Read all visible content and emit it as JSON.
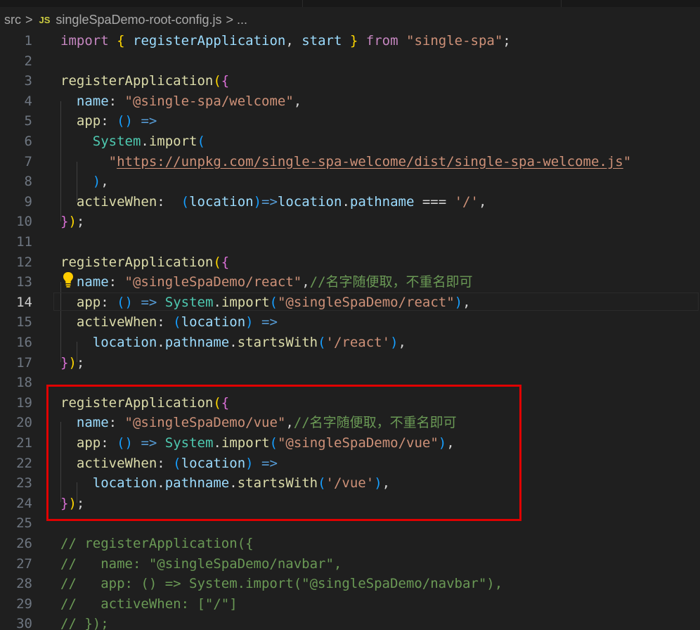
{
  "breadcrumb": {
    "folder": "src",
    "separator": ">",
    "file_icon": "JS",
    "file_name": "singleSpaDemo-root-config.js",
    "more": "..."
  },
  "editor": {
    "active_line": 14,
    "line_numbers": [
      "1",
      "2",
      "3",
      "4",
      "5",
      "6",
      "7",
      "8",
      "9",
      "10",
      "11",
      "12",
      "13",
      "14",
      "15",
      "16",
      "17",
      "18",
      "19",
      "20",
      "21",
      "22",
      "23",
      "24",
      "25",
      "26",
      "27",
      "28",
      "29",
      "30"
    ],
    "lines": [
      [
        [
          "kw",
          "import"
        ],
        [
          "txt",
          " "
        ],
        [
          "p1",
          "{"
        ],
        [
          "txt",
          " "
        ],
        [
          "prop",
          "registerApplication"
        ],
        [
          "txt",
          ", "
        ],
        [
          "prop",
          "start"
        ],
        [
          "txt",
          " "
        ],
        [
          "p1",
          "}"
        ],
        [
          "txt",
          " "
        ],
        [
          "kw",
          "from"
        ],
        [
          "txt",
          " "
        ],
        [
          "str",
          "\"single-spa\""
        ],
        [
          "txt",
          ";"
        ]
      ],
      [],
      [
        [
          "fn",
          "registerApplication"
        ],
        [
          "p1",
          "("
        ],
        [
          "p2",
          "{"
        ]
      ],
      [
        [
          "txt",
          "  "
        ],
        [
          "prop",
          "name"
        ],
        [
          "txt",
          ": "
        ],
        [
          "str",
          "\"@single-spa/welcome\""
        ],
        [
          "txt",
          ","
        ]
      ],
      [
        [
          "txt",
          "  "
        ],
        [
          "fn",
          "app"
        ],
        [
          "txt",
          ": "
        ],
        [
          "p3",
          "()"
        ],
        [
          "txt",
          " "
        ],
        [
          "kw2",
          "=>"
        ]
      ],
      [
        [
          "txt",
          "    "
        ],
        [
          "cls",
          "System"
        ],
        [
          "txt",
          "."
        ],
        [
          "fn",
          "import"
        ],
        [
          "p3",
          "("
        ]
      ],
      [
        [
          "txt",
          "      "
        ],
        [
          "str",
          "\""
        ],
        [
          "str url",
          "https://unpkg.com/single-spa-welcome/dist/single-spa-welcome.js"
        ],
        [
          "str",
          "\""
        ]
      ],
      [
        [
          "txt",
          "    "
        ],
        [
          "p3",
          ")"
        ],
        [
          "txt",
          ","
        ]
      ],
      [
        [
          "txt",
          "  "
        ],
        [
          "fn",
          "activeWhen"
        ],
        [
          "txt",
          ":  "
        ],
        [
          "p3",
          "("
        ],
        [
          "prop",
          "location"
        ],
        [
          "p3",
          ")"
        ],
        [
          "kw2",
          "=>"
        ],
        [
          "prop",
          "location"
        ],
        [
          "txt",
          "."
        ],
        [
          "prop",
          "pathname"
        ],
        [
          "txt",
          " === "
        ],
        [
          "str",
          "'/'"
        ],
        [
          "txt",
          ","
        ]
      ],
      [
        [
          "p2",
          "}"
        ],
        [
          "p1",
          ")"
        ],
        [
          "txt",
          ";"
        ]
      ],
      [],
      [
        [
          "fn",
          "registerApplication"
        ],
        [
          "p1",
          "("
        ],
        [
          "p2",
          "{"
        ]
      ],
      [
        [
          "txt",
          "  "
        ],
        [
          "prop",
          "name"
        ],
        [
          "txt",
          ": "
        ],
        [
          "str",
          "\"@singleSpaDemo/react\""
        ],
        [
          "txt",
          ","
        ],
        [
          "cmt",
          "//名字随便取，不重名即可"
        ]
      ],
      [
        [
          "txt",
          "  "
        ],
        [
          "fn",
          "app"
        ],
        [
          "txt",
          ": "
        ],
        [
          "p3",
          "()"
        ],
        [
          "txt",
          " "
        ],
        [
          "kw2",
          "=>"
        ],
        [
          "txt",
          " "
        ],
        [
          "cls",
          "System"
        ],
        [
          "txt",
          "."
        ],
        [
          "fn",
          "import"
        ],
        [
          "p3",
          "("
        ],
        [
          "str",
          "\"@singleSpaDemo/react\""
        ],
        [
          "p3",
          ")"
        ],
        [
          "txt",
          ","
        ]
      ],
      [
        [
          "txt",
          "  "
        ],
        [
          "fn",
          "activeWhen"
        ],
        [
          "txt",
          ": "
        ],
        [
          "p3",
          "("
        ],
        [
          "prop",
          "location"
        ],
        [
          "p3",
          ")"
        ],
        [
          "txt",
          " "
        ],
        [
          "kw2",
          "=>"
        ]
      ],
      [
        [
          "txt",
          "    "
        ],
        [
          "prop",
          "location"
        ],
        [
          "txt",
          "."
        ],
        [
          "prop",
          "pathname"
        ],
        [
          "txt",
          "."
        ],
        [
          "fn",
          "startsWith"
        ],
        [
          "p3",
          "("
        ],
        [
          "str",
          "'/react'"
        ],
        [
          "p3",
          ")"
        ],
        [
          "txt",
          ","
        ]
      ],
      [
        [
          "p2",
          "}"
        ],
        [
          "p1",
          ")"
        ],
        [
          "txt",
          ";"
        ]
      ],
      [],
      [
        [
          "fn",
          "registerApplication"
        ],
        [
          "p1",
          "("
        ],
        [
          "p2",
          "{"
        ]
      ],
      [
        [
          "txt",
          "  "
        ],
        [
          "prop",
          "name"
        ],
        [
          "txt",
          ": "
        ],
        [
          "str",
          "\"@singleSpaDemo/vue\""
        ],
        [
          "txt",
          ","
        ],
        [
          "cmt",
          "//名字随便取，不重名即可"
        ]
      ],
      [
        [
          "txt",
          "  "
        ],
        [
          "fn",
          "app"
        ],
        [
          "txt",
          ": "
        ],
        [
          "p3",
          "()"
        ],
        [
          "txt",
          " "
        ],
        [
          "kw2",
          "=>"
        ],
        [
          "txt",
          " "
        ],
        [
          "cls",
          "System"
        ],
        [
          "txt",
          "."
        ],
        [
          "fn",
          "import"
        ],
        [
          "p3",
          "("
        ],
        [
          "str",
          "\"@singleSpaDemo/vue\""
        ],
        [
          "p3",
          ")"
        ],
        [
          "txt",
          ","
        ]
      ],
      [
        [
          "txt",
          "  "
        ],
        [
          "fn",
          "activeWhen"
        ],
        [
          "txt",
          ": "
        ],
        [
          "p3",
          "("
        ],
        [
          "prop",
          "location"
        ],
        [
          "p3",
          ")"
        ],
        [
          "txt",
          " "
        ],
        [
          "kw2",
          "=>"
        ]
      ],
      [
        [
          "txt",
          "    "
        ],
        [
          "prop",
          "location"
        ],
        [
          "txt",
          "."
        ],
        [
          "prop",
          "pathname"
        ],
        [
          "txt",
          "."
        ],
        [
          "fn",
          "startsWith"
        ],
        [
          "p3",
          "("
        ],
        [
          "str",
          "'/vue'"
        ],
        [
          "p3",
          ")"
        ],
        [
          "txt",
          ","
        ]
      ],
      [
        [
          "p2",
          "}"
        ],
        [
          "p1",
          ")"
        ],
        [
          "txt",
          ";"
        ]
      ],
      [],
      [
        [
          "cmt",
          "// registerApplication({"
        ]
      ],
      [
        [
          "cmt",
          "//   name: \"@singleSpaDemo/navbar\","
        ]
      ],
      [
        [
          "cmt",
          "//   app: () => System.import(\"@singleSpaDemo/navbar\"),"
        ]
      ],
      [
        [
          "cmt",
          "//   activeWhen: [\"/\"]"
        ]
      ],
      [
        [
          "cmt",
          "// });"
        ]
      ]
    ]
  },
  "colors": {
    "background": "#1f1f1f",
    "highlight_box": "#e00000",
    "lightbulb": "#ffcc00"
  },
  "icons": {
    "lightbulb": "lightbulb-icon",
    "file_type": "js-file-icon"
  }
}
